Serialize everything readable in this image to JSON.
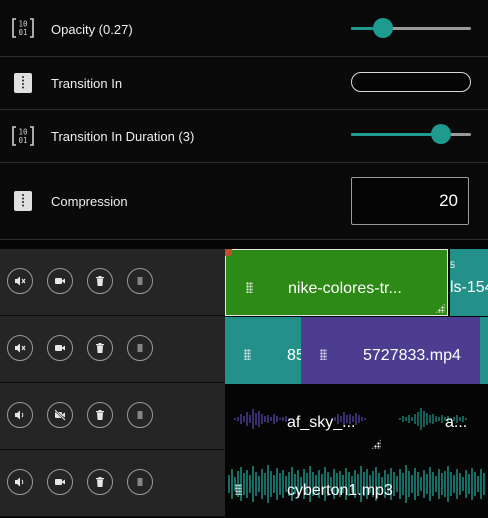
{
  "properties": {
    "opacity": {
      "label": "Opacity (0.27)",
      "value": 0.27
    },
    "transition_in": {
      "label": "Transition In",
      "value": ""
    },
    "transition_in_duration": {
      "label": "Transition In Duration (3)",
      "value": 3,
      "max": 4
    },
    "compression": {
      "label": "Compression",
      "value": "20"
    }
  },
  "timeline": {
    "ruler_mark": "5",
    "tracks": [
      {
        "clips": [
          "nike-colores-tr...",
          "ls-154"
        ],
        "audio": "muted",
        "video": "on"
      },
      {
        "clips": [
          "85",
          "5727833.mp4"
        ],
        "audio": "muted",
        "video": "on"
      },
      {
        "clips": [
          "af_sky_...",
          "a..."
        ],
        "audio": "on",
        "video": "off"
      },
      {
        "clips": [
          "cyberton1.mp3"
        ],
        "audio": "on",
        "video": "on"
      }
    ]
  },
  "colors": {
    "accent": "#1f9a8e",
    "clip_green": "#2e8a16",
    "clip_purple": "#4c3d91",
    "clip_teal": "#24908a",
    "audio_purple": "#5a4ab4",
    "audio_teal": "#1f9a8e"
  },
  "icons": {
    "number": "binary-number-icon",
    "text": "dotted-handle-icon",
    "mute": "speaker-muted-icon",
    "volume": "speaker-icon",
    "camera": "camera-icon",
    "camera_off": "camera-off-icon",
    "delete": "trash-icon",
    "menu": "hamburger-menu-icon"
  }
}
